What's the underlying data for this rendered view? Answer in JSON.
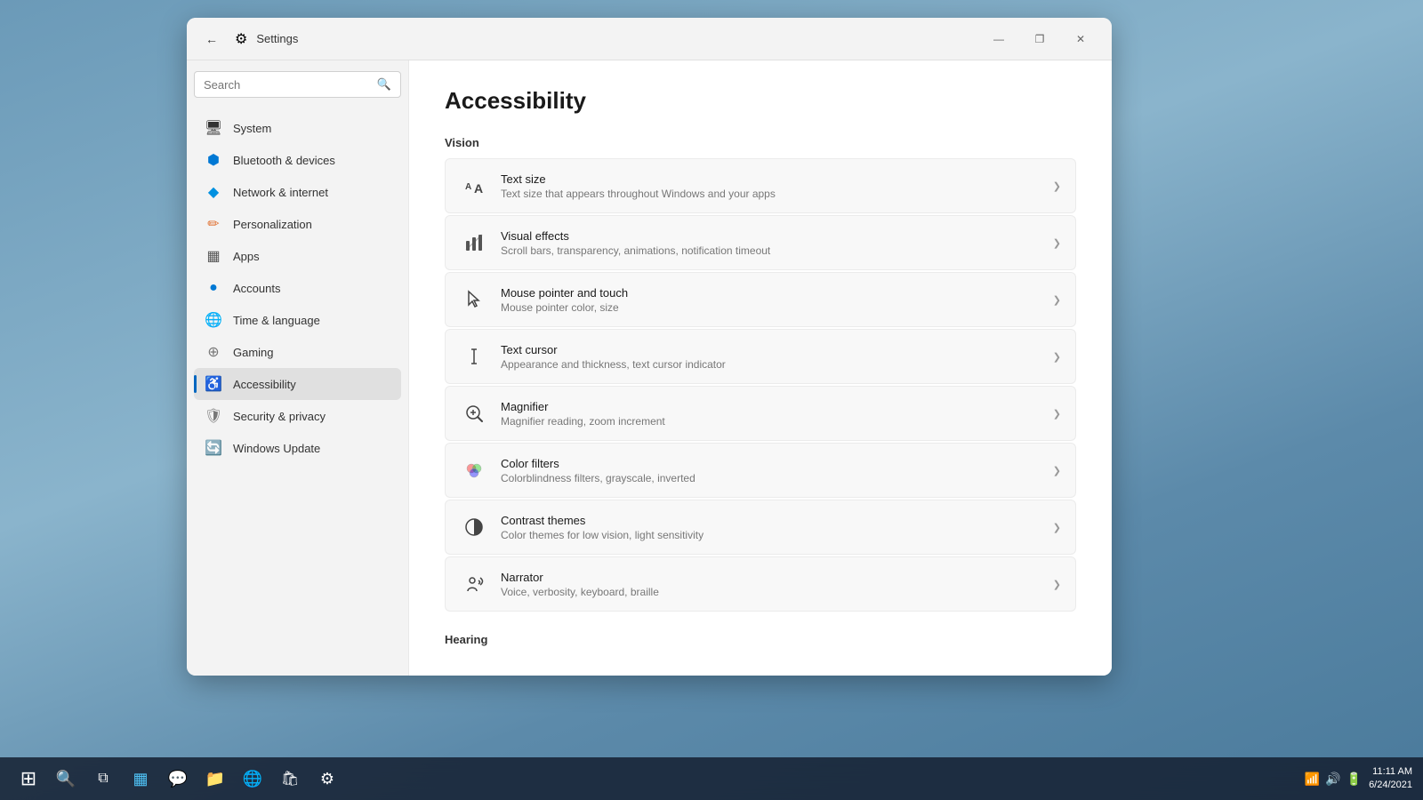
{
  "desktop": {
    "background": "blue gradient"
  },
  "taskbar": {
    "time": "11:11 AM",
    "date": "6/24/2021",
    "icons": [
      {
        "name": "start-icon",
        "symbol": "⊞",
        "label": "Start"
      },
      {
        "name": "search-taskbar-icon",
        "symbol": "🔍",
        "label": "Search"
      },
      {
        "name": "taskview-icon",
        "symbol": "❑",
        "label": "Task View"
      },
      {
        "name": "widgets-icon",
        "symbol": "▦",
        "label": "Widgets"
      },
      {
        "name": "chat-icon",
        "symbol": "💬",
        "label": "Chat"
      },
      {
        "name": "explorer-icon",
        "symbol": "📁",
        "label": "File Explorer"
      },
      {
        "name": "edge-icon",
        "symbol": "🌐",
        "label": "Edge"
      },
      {
        "name": "store-icon",
        "symbol": "🛍",
        "label": "Store"
      },
      {
        "name": "settings-taskbar-icon",
        "symbol": "⚙",
        "label": "Settings"
      }
    ]
  },
  "window": {
    "title": "Settings",
    "controls": {
      "minimize": "—",
      "maximize": "❐",
      "close": "✕"
    }
  },
  "sidebar": {
    "search_placeholder": "Search",
    "items": [
      {
        "id": "system",
        "label": "System",
        "icon": "🖥",
        "active": false
      },
      {
        "id": "bluetooth",
        "label": "Bluetooth & devices",
        "icon": "🔷",
        "active": false
      },
      {
        "id": "network",
        "label": "Network & internet",
        "icon": "💎",
        "active": false
      },
      {
        "id": "personalization",
        "label": "Personalization",
        "icon": "✏",
        "active": false
      },
      {
        "id": "apps",
        "label": "Apps",
        "icon": "▦",
        "active": false
      },
      {
        "id": "accounts",
        "label": "Accounts",
        "icon": "👤",
        "active": false
      },
      {
        "id": "time",
        "label": "Time & language",
        "icon": "🌐",
        "active": false
      },
      {
        "id": "gaming",
        "label": "Gaming",
        "icon": "🎮",
        "active": false
      },
      {
        "id": "accessibility",
        "label": "Accessibility",
        "icon": "♿",
        "active": true
      },
      {
        "id": "security",
        "label": "Security & privacy",
        "icon": "🛡",
        "active": false
      },
      {
        "id": "update",
        "label": "Windows Update",
        "icon": "🔄",
        "active": false
      }
    ]
  },
  "main": {
    "page_title": "Accessibility",
    "sections": [
      {
        "id": "vision",
        "label": "Vision",
        "items": [
          {
            "id": "text-size",
            "title": "Text size",
            "description": "Text size that appears throughout Windows and your apps",
            "icon": "🅰"
          },
          {
            "id": "visual-effects",
            "title": "Visual effects",
            "description": "Scroll bars, transparency, animations, notification timeout",
            "icon": "✨"
          },
          {
            "id": "mouse-pointer",
            "title": "Mouse pointer and touch",
            "description": "Mouse pointer color, size",
            "icon": "🖱"
          },
          {
            "id": "text-cursor",
            "title": "Text cursor",
            "description": "Appearance and thickness, text cursor indicator",
            "icon": "𝐈"
          },
          {
            "id": "magnifier",
            "title": "Magnifier",
            "description": "Magnifier reading, zoom increment",
            "icon": "🔍"
          },
          {
            "id": "color-filters",
            "title": "Color filters",
            "description": "Colorblindness filters, grayscale, inverted",
            "icon": "🎨"
          },
          {
            "id": "contrast-themes",
            "title": "Contrast themes",
            "description": "Color themes for low vision, light sensitivity",
            "icon": "◑"
          },
          {
            "id": "narrator",
            "title": "Narrator",
            "description": "Voice, verbosity, keyboard, braille",
            "icon": "🔊"
          }
        ]
      },
      {
        "id": "hearing",
        "label": "Hearing",
        "items": []
      }
    ]
  }
}
